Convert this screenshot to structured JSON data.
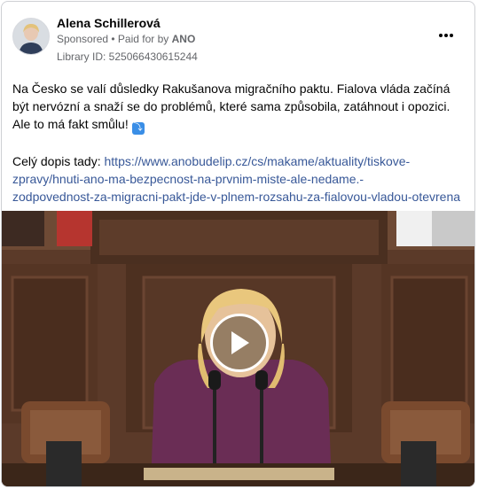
{
  "post": {
    "author": "Alena Schillerová",
    "sponsored_label": "Sponsored",
    "separator": " • ",
    "paid_for_prefix": "Paid for by ",
    "paid_for_by": "ANO",
    "library_id": "Library ID: 525066430615244",
    "body_text": "Na Česko se valí důsledky Rakušanova migračního paktu. Fialova vláda začíná být nervózní a snaží se do problémů, které sama způsobila, zatáhnout i opozici. Ale to má fakt smůlu!",
    "emoji": "⤵",
    "link_prefix": "Celý dopis tady: ",
    "link_line1": "https://www.anobudelip.cz/cs/makame/aktuality/tiskove-",
    "link_line2": "zpravy/hnuti-ano-ma-bezpecnost-na-prvnim-miste-ale-nedame.-",
    "link_line3": "zodpovednost-za-migracni-pakt-jde-v-plnem-rozsahu-za-fialovou-vladou-otevrena-..."
  },
  "icons": {
    "more": "more-options-icon",
    "play": "play-icon"
  },
  "colors": {
    "link": "#385898",
    "secondary_text": "#65676b",
    "card_border": "#ced0d4"
  }
}
